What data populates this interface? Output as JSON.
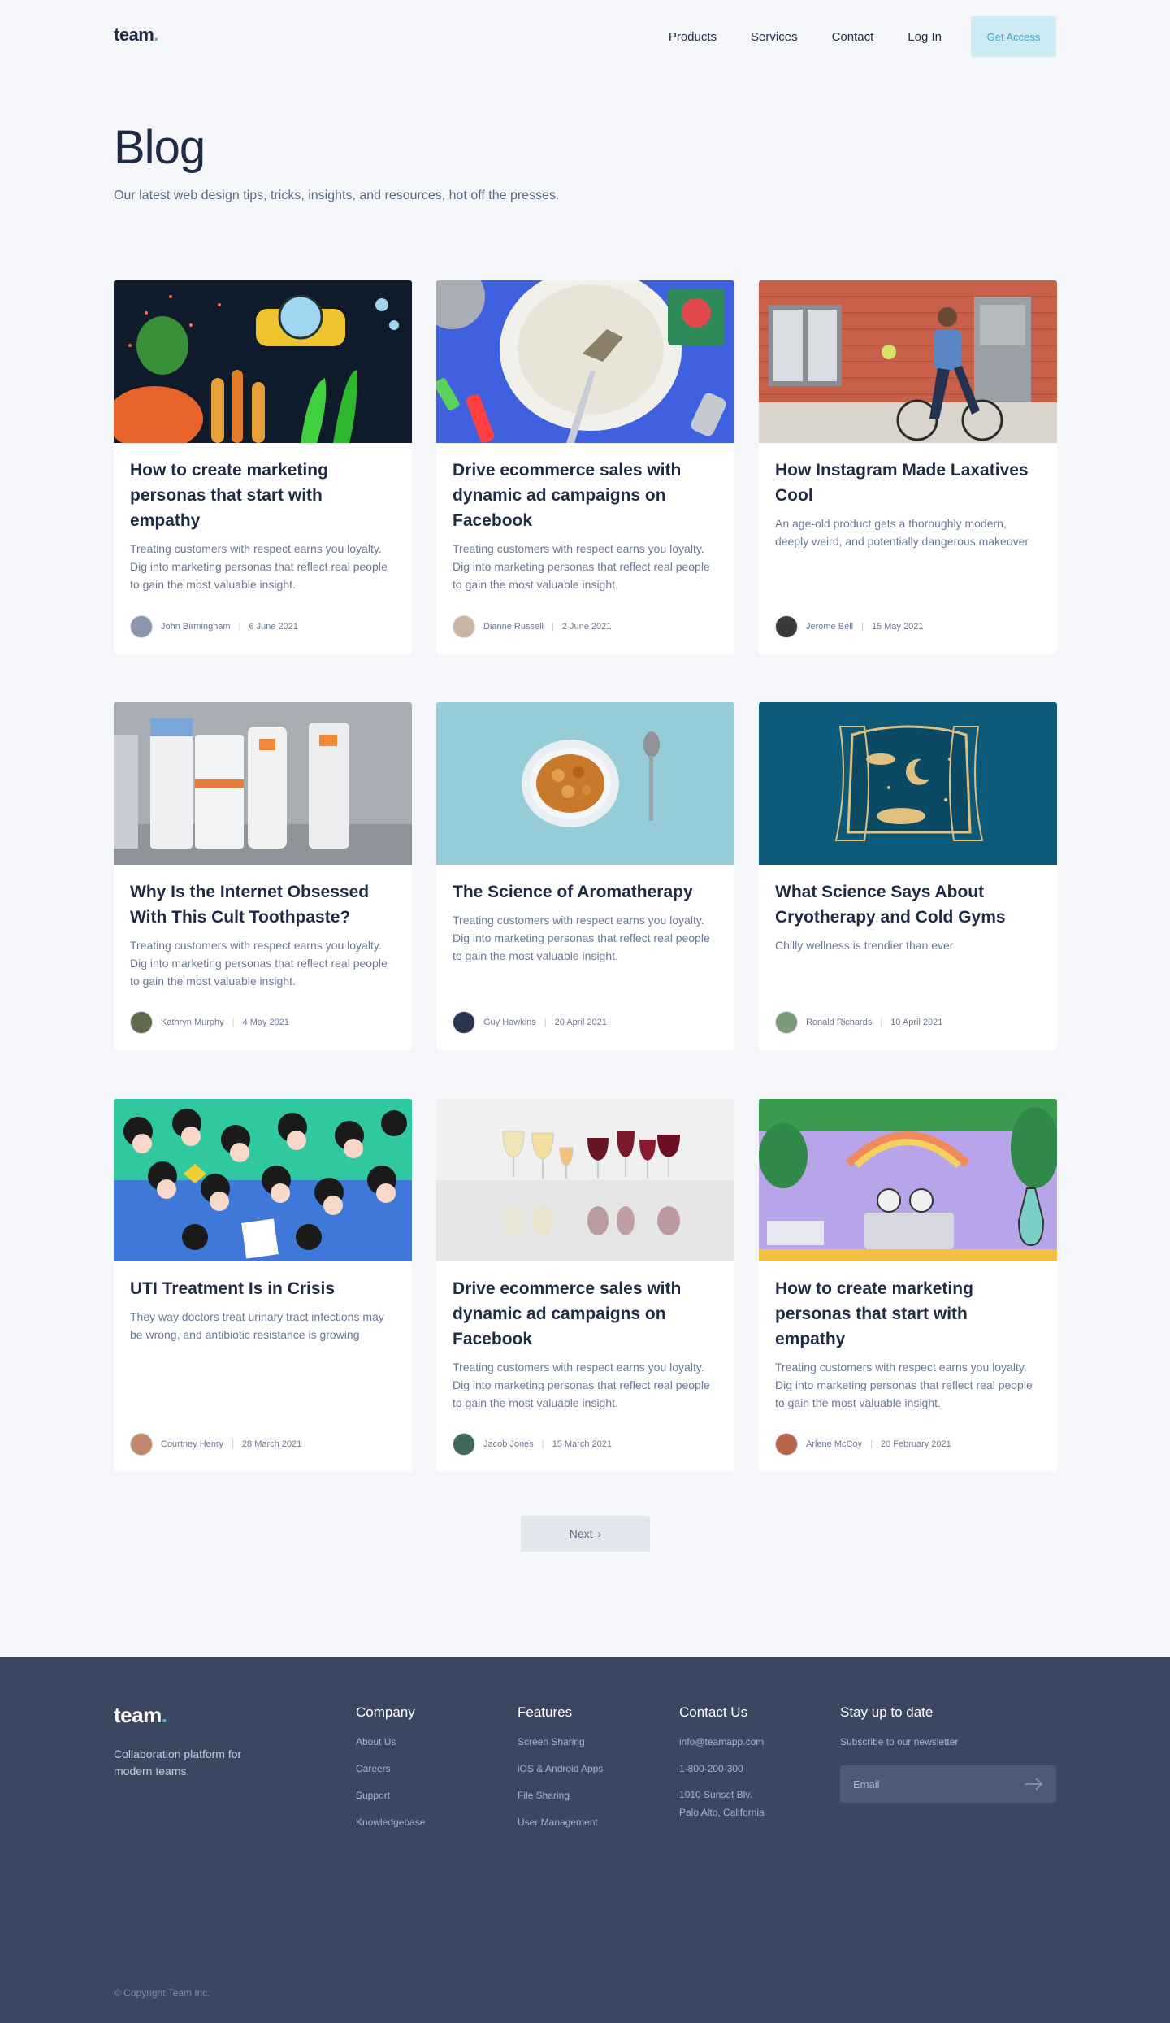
{
  "header": {
    "logo": "team",
    "logo_dot": ".",
    "nav": [
      "Products",
      "Services",
      "Contact",
      "Log In"
    ],
    "cta": "Get Access"
  },
  "hero": {
    "title": "Blog",
    "subtitle": "Our latest web design tips, tricks, insights, and resources, hot off the presses."
  },
  "posts": [
    {
      "title": "How to create marketing personas that start with empathy",
      "desc": "Treating customers with respect earns you loyalty. Dig into marketing personas that reflect real people to gain the most valuable insight.",
      "author": "John Birmingham",
      "date": "6 June 2021",
      "image": "underwater-submarine-illustration"
    },
    {
      "title": "Drive ecommerce sales with dynamic ad campaigns on Facebook",
      "desc": "Treating customers with respect earns you loyalty. Dig into marketing personas that reflect real people to gain the most valuable insight.",
      "author": "Dianne Russell",
      "date": "2 June 2021",
      "image": "plate-with-fish-bones"
    },
    {
      "title": "How Instagram Made Laxatives Cool",
      "desc": "An age-old product gets a thoroughly modern, deeply weird, and potentially dangerous makeover",
      "author": "Jerome Bell",
      "date": "15 May 2021",
      "image": "man-riding-bicycle"
    },
    {
      "title": "Why Is the Internet Obsessed With This Cult Toothpaste?",
      "desc": "Treating customers with respect earns you loyalty. Dig into marketing personas that reflect real people to gain the most valuable insight.",
      "author": "Kathryn Murphy",
      "date": "4 May 2021",
      "image": "sunscreen-bottles"
    },
    {
      "title": "The Science of Aromatherapy",
      "desc": "Treating customers with respect earns you loyalty. Dig into marketing personas that reflect real people to gain the most valuable insight.",
      "author": "Guy Hawkins",
      "date": "20 April 2021",
      "image": "cereal-bowl-and-spoon"
    },
    {
      "title": "What Science Says About Cryotherapy and Cold Gyms",
      "desc": "Chilly wellness is trendier than ever",
      "author": "Ronald Richards",
      "date": "10 April 2021",
      "image": "night-window-curtains"
    },
    {
      "title": "UTI Treatment Is in Crisis",
      "desc": "They way doctors treat urinary tract infections may be wrong, and antibiotic resistance is growing",
      "author": "Courtney Henry",
      "date": "28 March 2021",
      "image": "crowd-illustration"
    },
    {
      "title": "Drive ecommerce sales with dynamic ad campaigns on Facebook",
      "desc": "Treating customers with respect earns you loyalty. Dig into marketing personas that reflect real people to gain the most valuable insight.",
      "author": "Jacob Jones",
      "date": "15 March 2021",
      "image": "wine-glasses"
    },
    {
      "title": "How to create marketing personas that start with empathy",
      "desc": "Treating customers with respect earns you loyalty. Dig into marketing personas that reflect real people to gain the most valuable insight.",
      "author": "Arlene McCoy",
      "date": "20 February 2021",
      "image": "frogs-lab-illustration"
    }
  ],
  "pagination": {
    "next": "Next"
  },
  "footer": {
    "logo": "team",
    "logo_dot": ".",
    "tagline": "Collaboration platform for modern teams.",
    "company": {
      "heading": "Company",
      "links": [
        "About Us",
        "Careers",
        "Support",
        "Knowledgebase"
      ]
    },
    "features": {
      "heading": "Features",
      "links": [
        "Screen Sharing",
        "iOS & Android Apps",
        "File Sharing",
        "User Management"
      ]
    },
    "contact": {
      "heading": "Contact Us",
      "email": "info@teamapp.com",
      "phone": "1-800-200-300",
      "address_line1": "1010 Sunset Blv.",
      "address_line2": "Palo Alto, California"
    },
    "newsletter": {
      "heading": "Stay up to date",
      "sub": "Subscribe to our newsletter",
      "placeholder": "Email"
    },
    "copyright": "© Copyright Team Inc."
  },
  "colors": {
    "accent": "#4fb9d9",
    "footer_bg": "#3b4761",
    "page_bg": "#f4f6fa"
  }
}
